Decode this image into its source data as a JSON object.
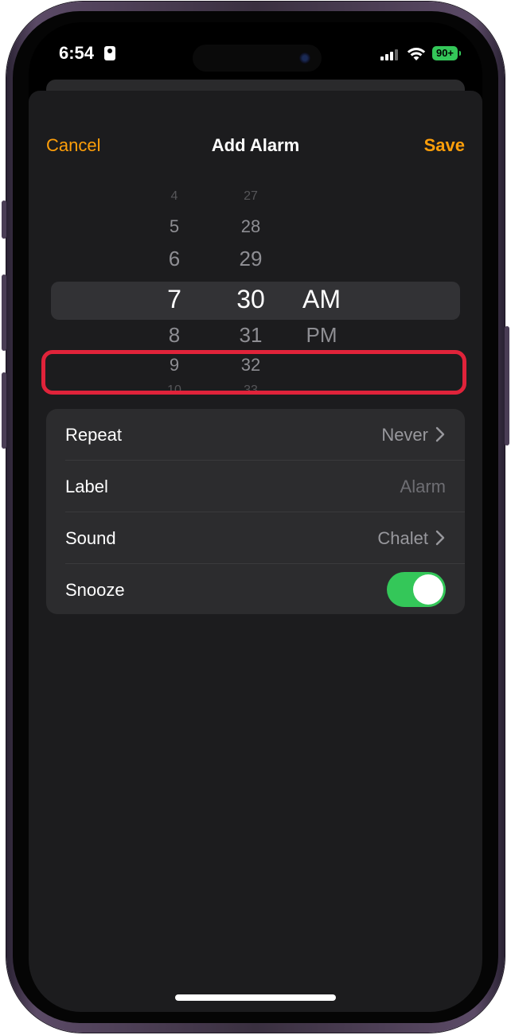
{
  "status_bar": {
    "time": "6:54",
    "battery": "90+"
  },
  "navigation": {
    "cancel_label": "Cancel",
    "title": "Add Alarm",
    "save_label": "Save"
  },
  "picker": {
    "hours": [
      "4",
      "5",
      "6",
      "7",
      "8",
      "9",
      "10"
    ],
    "minutes": [
      "27",
      "28",
      "29",
      "30",
      "31",
      "32",
      "33"
    ],
    "periods": [
      "AM",
      "PM"
    ],
    "selected_hour": "7",
    "selected_minute": "30",
    "selected_period": "AM"
  },
  "settings": {
    "repeat": {
      "label": "Repeat",
      "value": "Never"
    },
    "label": {
      "label": "Label",
      "placeholder": "Alarm"
    },
    "sound": {
      "label": "Sound",
      "value": "Chalet"
    },
    "snooze": {
      "label": "Snooze",
      "on": true
    }
  },
  "colors": {
    "accent": "#ff9f0a",
    "toggle_on": "#34c759",
    "highlight": "#e0233a"
  }
}
